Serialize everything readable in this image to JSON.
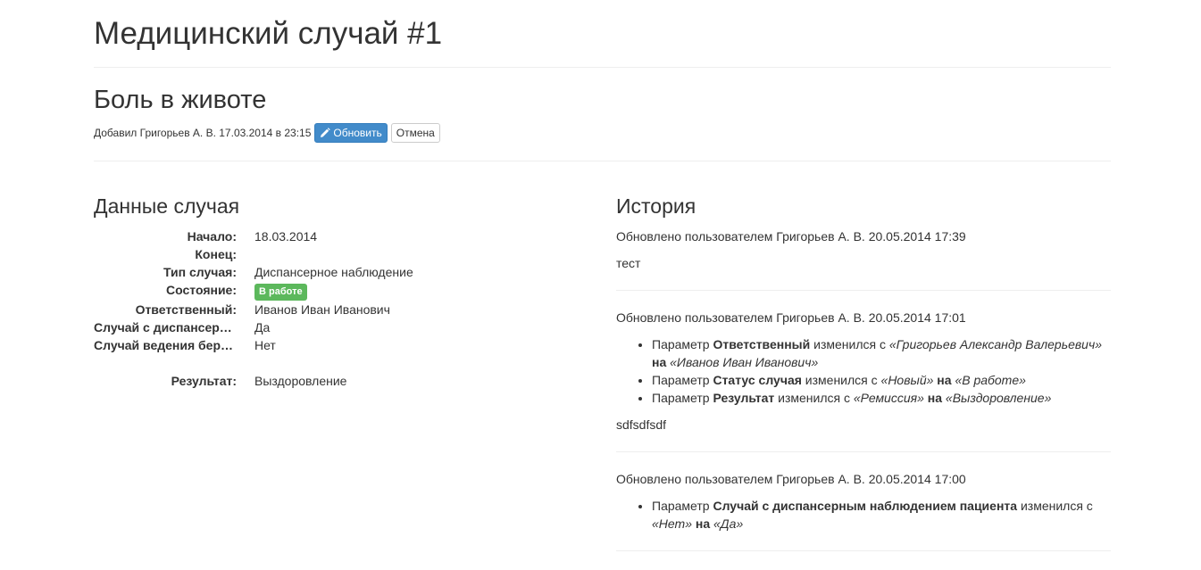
{
  "page": {
    "title": "Медицинский случай #1"
  },
  "case": {
    "title": "Боль в животе",
    "added_by": "Добавил Григорьев А. В. 17.03.2014 в 23:15",
    "update_label": "Обновить",
    "cancel_label": "Отмена"
  },
  "details": {
    "title": "Данные случая",
    "fields": [
      {
        "label": "Начало:",
        "value": "18.03.2014"
      },
      {
        "label": "Конец:",
        "value": ""
      },
      {
        "label": "Тип случая:",
        "value": "Диспансерное наблюдение"
      },
      {
        "label": "Состояние:",
        "value": "В работе",
        "badge_color": "#5cb85c"
      },
      {
        "label": "Ответственный:",
        "value": "Иванов Иван Иванович"
      },
      {
        "label": "Случай с диспансерным наблюдением пациента",
        "value": "Да"
      },
      {
        "label": "Случай ведения беременности",
        "value": "Нет"
      },
      {
        "label": "Результат:",
        "value": "Выздоровление"
      }
    ]
  },
  "history": {
    "title": "История",
    "entries": [
      {
        "header": "Обновлено пользователем Григорьев А. В. 20.05.2014 17:39",
        "comment": "тест"
      },
      {
        "header": "Обновлено пользователем Григорьев А. В. 20.05.2014 17:01",
        "changes": [
          {
            "prefix": "Параметр ",
            "param": "Ответственный",
            "mid": " изменился с ",
            "from": "«Григорьев Александр Валерьевич»",
            "to_word": "на",
            "to": "«Иванов Иван Иванович»"
          },
          {
            "prefix": "Параметр ",
            "param": "Статус случая",
            "mid": " изменился с ",
            "from": "«Новый»",
            "to_word": "на",
            "to": "«В работе»"
          },
          {
            "prefix": "Параметр ",
            "param": "Результат",
            "mid": " изменился с ",
            "from": "«Ремиссия»",
            "to_word": "на",
            "to": "«Выздоровление»"
          }
        ],
        "comment": "sdfsdfsdf"
      },
      {
        "header": "Обновлено пользователем Григорьев А. В. 20.05.2014 17:00",
        "changes": [
          {
            "prefix": "Параметр ",
            "param": "Случай с диспансерным наблюдением пациента",
            "mid": " изменился с ",
            "from": "«Нет»",
            "to_word": "на",
            "to": "«Да»"
          }
        ]
      }
    ]
  },
  "icons": {
    "update": "pencil-icon"
  },
  "colors": {
    "primary": "#428bca",
    "success": "#5cb85c"
  }
}
